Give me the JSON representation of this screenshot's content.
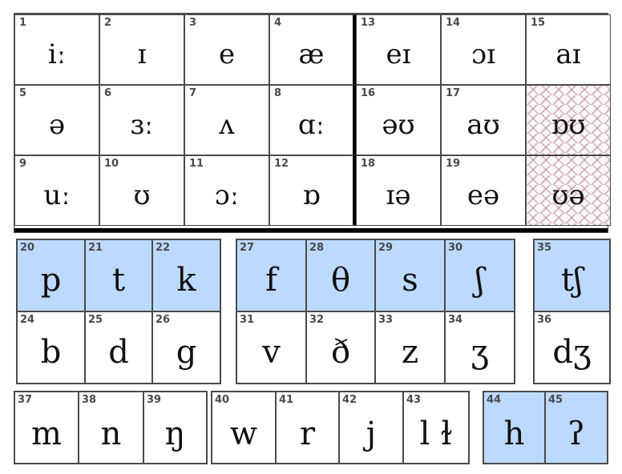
{
  "colors": {
    "voiceless_highlight": "#bcdaff",
    "border": "#4a4a4a",
    "separator": "#000000",
    "pattern": "#aa788c"
  },
  "vowels": {
    "monophthongs": [
      {
        "num": "1",
        "symbol": "iː"
      },
      {
        "num": "2",
        "symbol": "ɪ"
      },
      {
        "num": "3",
        "symbol": "e"
      },
      {
        "num": "4",
        "symbol": "æ"
      },
      {
        "num": "5",
        "symbol": "ə"
      },
      {
        "num": "6",
        "symbol": "ɜː"
      },
      {
        "num": "7",
        "symbol": "ʌ"
      },
      {
        "num": "8",
        "symbol": "ɑː"
      },
      {
        "num": "9",
        "symbol": "uː"
      },
      {
        "num": "10",
        "symbol": "ʊ"
      },
      {
        "num": "11",
        "symbol": "ɔː"
      },
      {
        "num": "12",
        "symbol": "ɒ"
      }
    ],
    "diphthongs": [
      {
        "num": "13",
        "symbol": "eɪ"
      },
      {
        "num": "14",
        "symbol": "ɔɪ"
      },
      {
        "num": "15",
        "symbol": "aɪ"
      },
      {
        "num": "16",
        "symbol": "əʊ"
      },
      {
        "num": "17",
        "symbol": "aʊ"
      },
      {
        "num": "",
        "symbol": "ɒʊ",
        "patterned": true
      },
      {
        "num": "18",
        "symbol": "ɪə"
      },
      {
        "num": "19",
        "symbol": "eə"
      },
      {
        "num": "",
        "symbol": "ʊə",
        "patterned": true
      }
    ]
  },
  "consonants": {
    "plosives": [
      {
        "num": "20",
        "symbol": "p",
        "voiceless": true
      },
      {
        "num": "21",
        "symbol": "t",
        "voiceless": true
      },
      {
        "num": "22",
        "symbol": "k",
        "voiceless": true
      },
      {
        "num": "24",
        "symbol": "b"
      },
      {
        "num": "25",
        "symbol": "d"
      },
      {
        "num": "26",
        "symbol": "g"
      }
    ],
    "fricatives": [
      {
        "num": "27",
        "symbol": "f",
        "voiceless": true
      },
      {
        "num": "28",
        "symbol": "θ",
        "voiceless": true
      },
      {
        "num": "29",
        "symbol": "s",
        "voiceless": true
      },
      {
        "num": "30",
        "symbol": "ʃ",
        "voiceless": true
      },
      {
        "num": "31",
        "symbol": "v"
      },
      {
        "num": "32",
        "symbol": "ð"
      },
      {
        "num": "33",
        "symbol": "z"
      },
      {
        "num": "34",
        "symbol": "ʒ"
      }
    ],
    "affricates": [
      {
        "num": "35",
        "symbol": "tʃ",
        "voiceless": true
      },
      {
        "num": "36",
        "symbol": "dʒ"
      }
    ],
    "nasals": [
      {
        "num": "37",
        "symbol": "m"
      },
      {
        "num": "38",
        "symbol": "n"
      },
      {
        "num": "39",
        "symbol": "ŋ"
      }
    ],
    "approximants": [
      {
        "num": "40",
        "symbol": "w"
      },
      {
        "num": "41",
        "symbol": "r"
      },
      {
        "num": "42",
        "symbol": "j"
      },
      {
        "num": "43",
        "symbol": "l ɫ"
      }
    ],
    "glottals": [
      {
        "num": "44",
        "symbol": "h",
        "voiceless": true
      },
      {
        "num": "45",
        "symbol": "ʔ",
        "voiceless": true
      }
    ]
  }
}
